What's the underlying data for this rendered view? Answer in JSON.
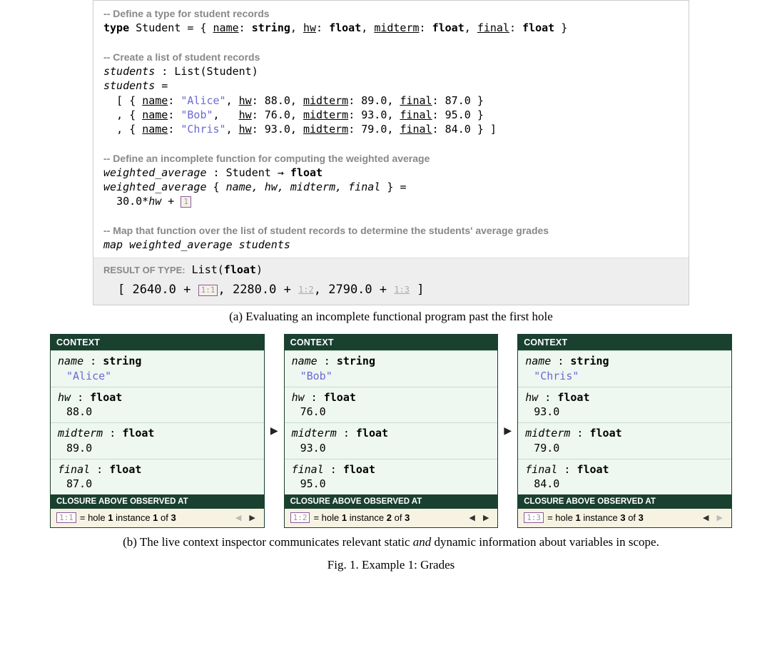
{
  "code": {
    "c1": "-- Define a type for student records",
    "c2": "-- Create a list of student records",
    "c3": "-- Define an incomplete function for computing the weighted average",
    "c4": "-- Map that function over the list of student records to determine the students' average grades",
    "type_kw": "type",
    "type_name": "Student",
    "eq": "=",
    "lbrace": "{",
    "rbrace": "}",
    "name_f": "name",
    "string_t": "string",
    "hw_f": "hw",
    "float_t": "float",
    "midterm_f": "midterm",
    "final_f": "final",
    "colon": ":",
    "comma": ",",
    "students_decl1": "students",
    "list_open": "List(Student)",
    "students_decl2": "students",
    "open_br": "[",
    "close_br": "]",
    "s1_name": "\"Alice\"",
    "s1_hw": "88.0",
    "s1_mid": "89.0",
    "s1_fin": "87.0",
    "s2_name": "\"Bob\"",
    "s2_hw": "76.0",
    "s2_mid": "93.0",
    "s2_fin": "95.0",
    "s3_name": "\"Chris\"",
    "s3_hw": "93.0",
    "s3_mid": "79.0",
    "s3_fin": "84.0",
    "wa_name": "weighted_average",
    "arrow": "→",
    "wa_args_open": "{",
    "wa_args_list": "name, hw, midterm, final",
    "wa_args_close": "}",
    "wa_body_l": "30.0*",
    "wa_body_var": "hw",
    "wa_plus": " + ",
    "hole1": "1",
    "map_line_a": "map weighted_average students"
  },
  "result": {
    "label": "RESULT OF TYPE:",
    "type_open": "List(",
    "type_bold": "float",
    "type_close": ")",
    "open": "[ ",
    "v1": "2640.0 + ",
    "h1": "1:1",
    "v2": ", 2280.0 + ",
    "h2": "1:2",
    "v3": ", 2790.0 + ",
    "h3": "1:3",
    "close": " ]"
  },
  "captions": {
    "a": "(a) Evaluating an incomplete functional program past the first hole",
    "b_pre": "(b) The live context inspector communicates relevant static ",
    "b_em": "and",
    "b_post": " dynamic information about variables in scope.",
    "fig": "Fig. 1.  Example 1: Grades"
  },
  "inspector": {
    "context_label": "CONTEXT",
    "closure_label": "CLOSURE ABOVE OBSERVED AT",
    "cols": [
      {
        "vars": [
          {
            "name": "name",
            "type": "string",
            "value": "\"Alice\"",
            "is_str": true
          },
          {
            "name": "hw",
            "type": "float",
            "value": "88.0"
          },
          {
            "name": "midterm",
            "type": "float",
            "value": "89.0"
          },
          {
            "name": "final",
            "type": "float",
            "value": "87.0"
          }
        ],
        "hole": "1:1",
        "foot_pre": "= hole ",
        "foot_h": "1",
        "foot_mid": " instance ",
        "foot_i": "1",
        "foot_of": " of ",
        "foot_n": "3",
        "prev_dim": true,
        "next_dim": false
      },
      {
        "vars": [
          {
            "name": "name",
            "type": "string",
            "value": "\"Bob\"",
            "is_str": true
          },
          {
            "name": "hw",
            "type": "float",
            "value": "76.0"
          },
          {
            "name": "midterm",
            "type": "float",
            "value": "93.0"
          },
          {
            "name": "final",
            "type": "float",
            "value": "95.0"
          }
        ],
        "hole": "1:2",
        "foot_pre": "= hole ",
        "foot_h": "1",
        "foot_mid": " instance ",
        "foot_i": "2",
        "foot_of": " of ",
        "foot_n": "3",
        "prev_dim": false,
        "next_dim": false
      },
      {
        "vars": [
          {
            "name": "name",
            "type": "string",
            "value": "\"Chris\"",
            "is_str": true
          },
          {
            "name": "hw",
            "type": "float",
            "value": "93.0"
          },
          {
            "name": "midterm",
            "type": "float",
            "value": "79.0"
          },
          {
            "name": "final",
            "type": "float",
            "value": "84.0"
          }
        ],
        "hole": "1:3",
        "foot_pre": "= hole ",
        "foot_h": "1",
        "foot_mid": " instance ",
        "foot_i": "3",
        "foot_of": " of ",
        "foot_n": "3",
        "prev_dim": false,
        "next_dim": true
      }
    ]
  }
}
